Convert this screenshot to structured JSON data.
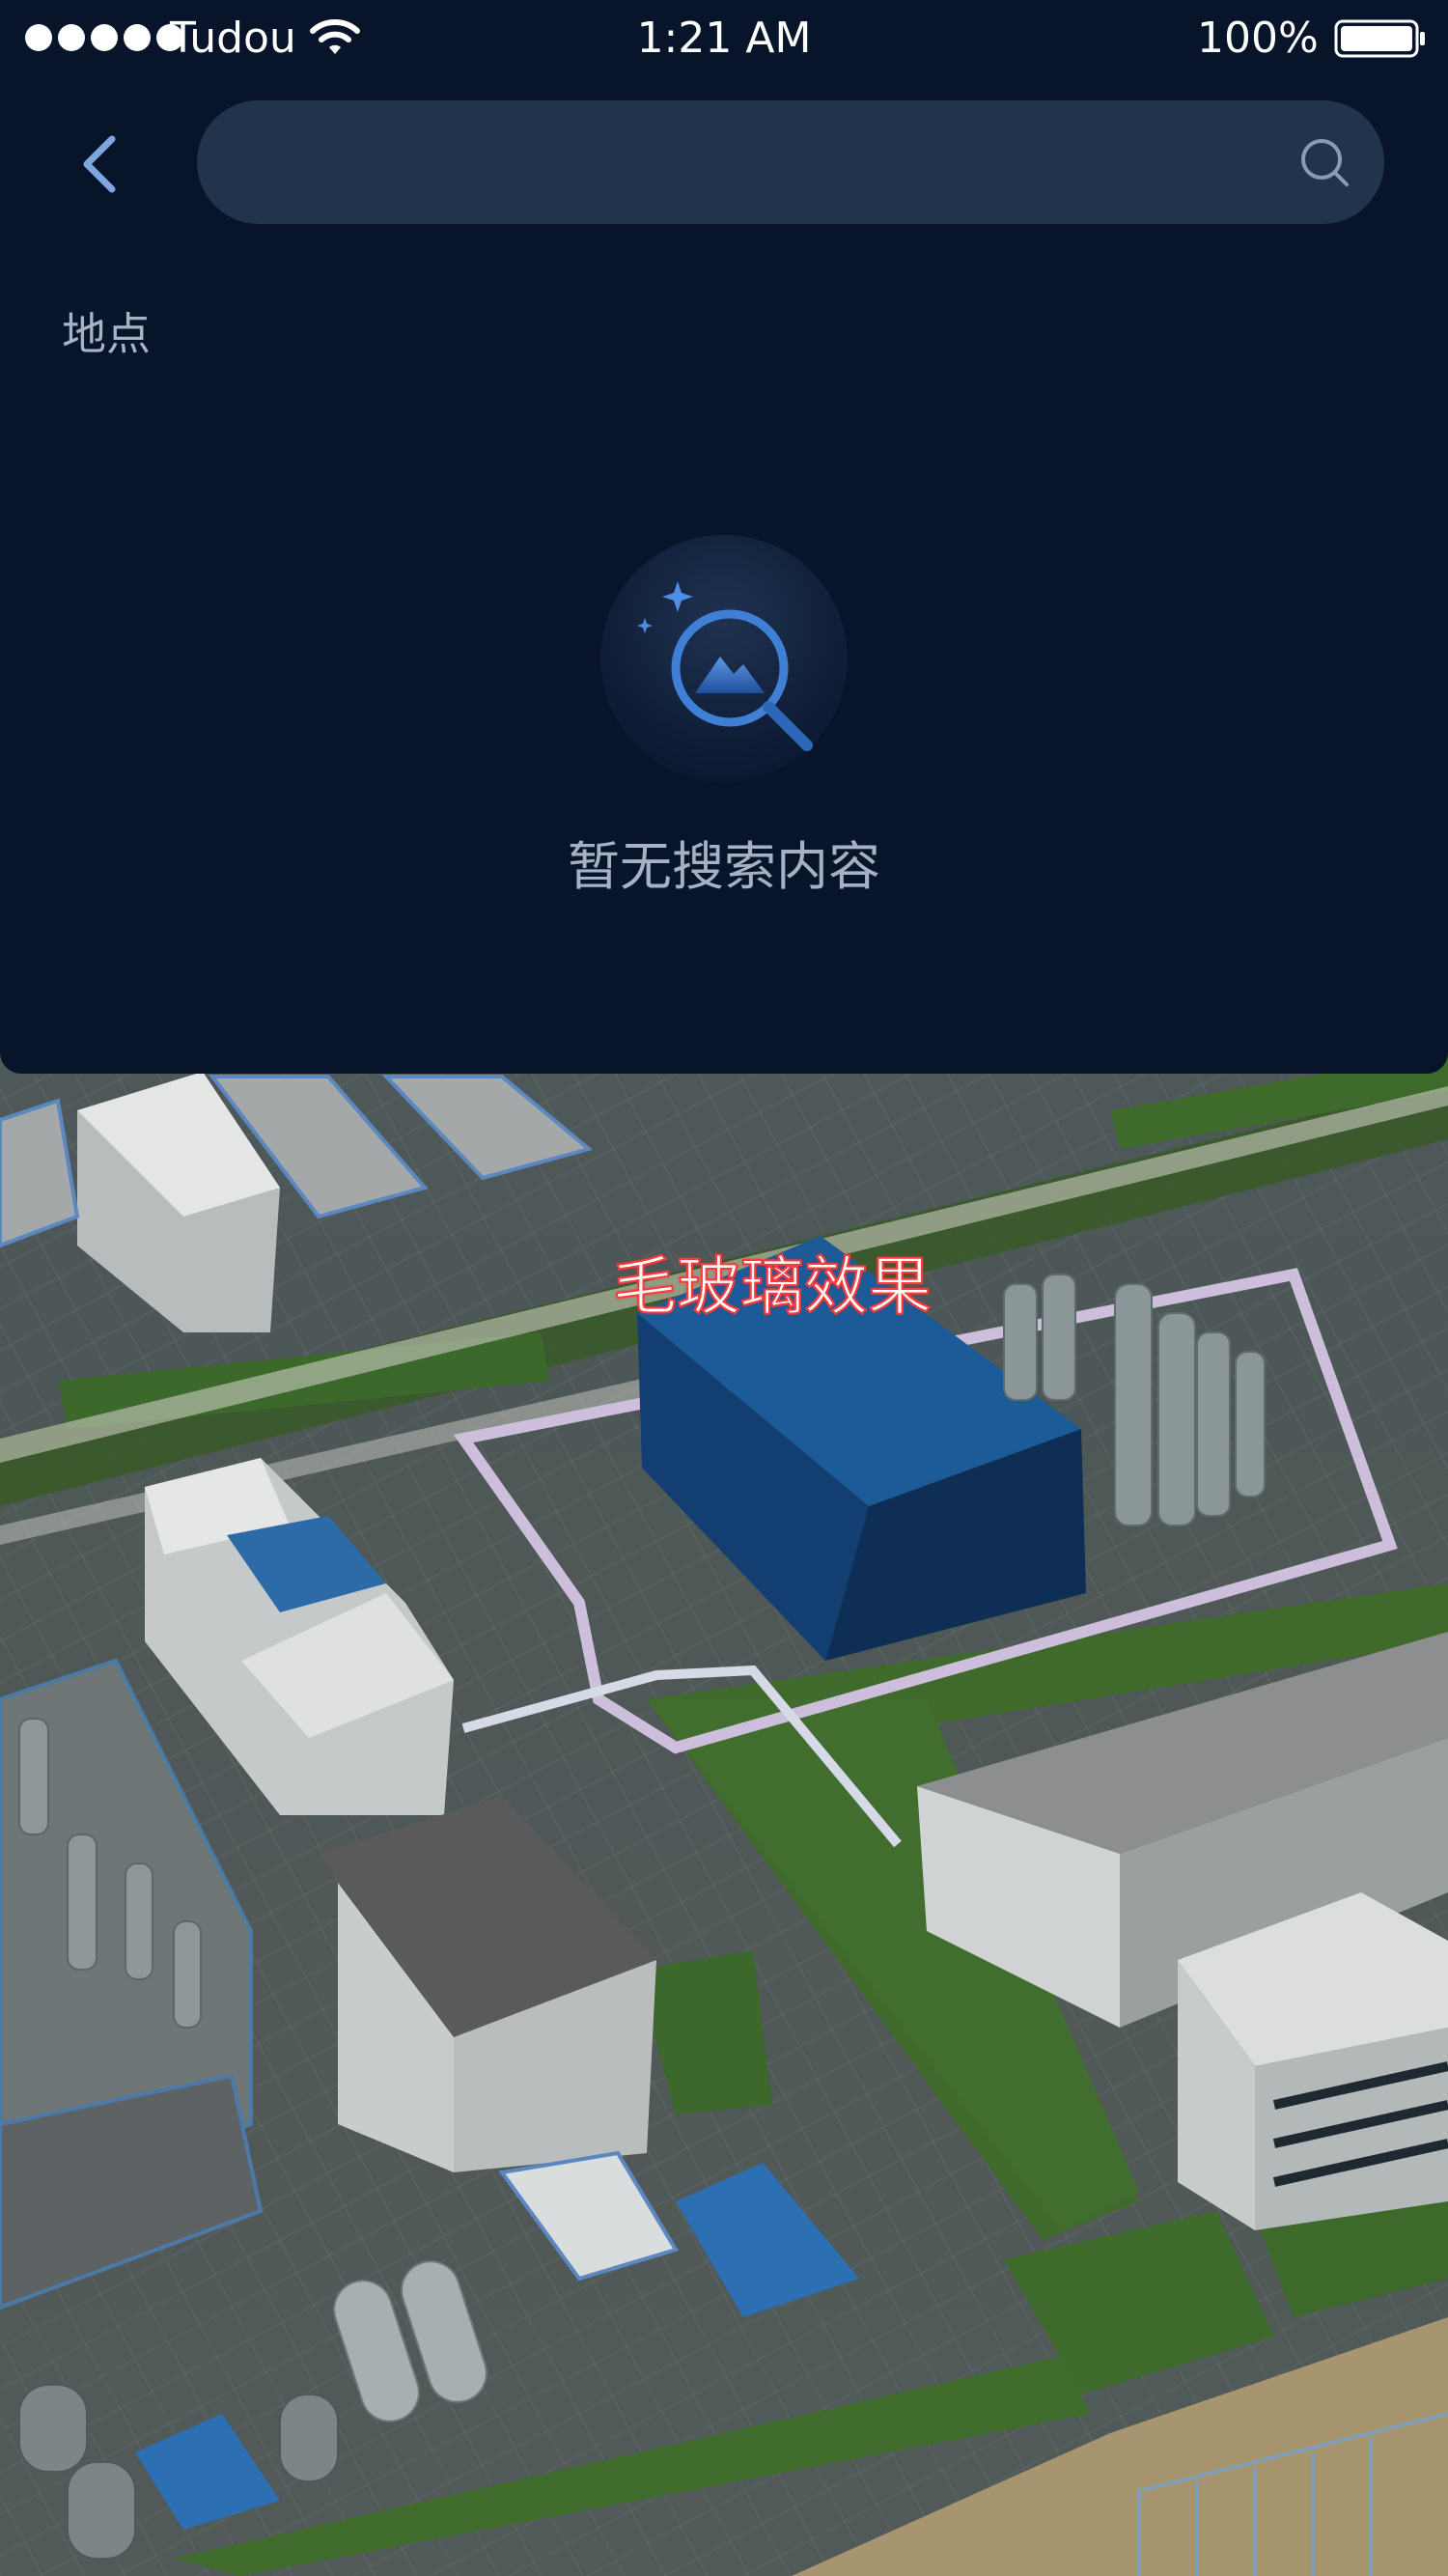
{
  "status_bar": {
    "carrier": "Tudou",
    "time": "1:21 AM",
    "battery_percent": "100%",
    "icons": [
      "signal-dots-icon",
      "wifi-icon",
      "battery-icon"
    ]
  },
  "header": {
    "back_icon": "chevron-left-icon",
    "search": {
      "value": "",
      "placeholder": "",
      "icon": "search-icon"
    }
  },
  "section": {
    "label": "地点"
  },
  "empty_state": {
    "icon": "empty-search-icon",
    "message": "暂无搜索内容"
  },
  "map": {
    "label": "毛玻璃效果",
    "label_colors": {
      "fill": "#ffffff",
      "outline": "#ff3b3b"
    }
  },
  "colors": {
    "panel_background": "#071429",
    "search_background": "#22334c",
    "accent_blue": "#3f7fd6",
    "muted_text": "#a8b4c6"
  }
}
